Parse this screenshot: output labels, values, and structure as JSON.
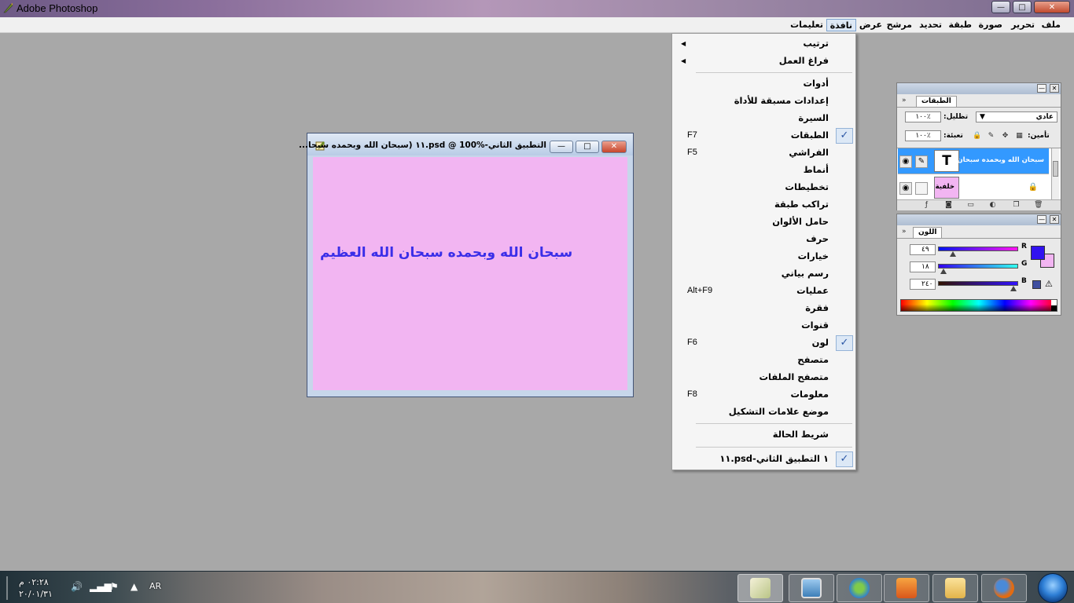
{
  "app": {
    "title": "Adobe Photoshop"
  },
  "window_controls": {
    "minimize": "—",
    "maximize": "□",
    "close": "✕"
  },
  "menubar": {
    "items": [
      {
        "label": "ملف"
      },
      {
        "label": "تحرير"
      },
      {
        "label": "صورة"
      },
      {
        "label": "طبقة"
      },
      {
        "label": "تحديد"
      },
      {
        "label": "مرشح"
      },
      {
        "label": "عرض"
      },
      {
        "label": "نافذة",
        "active": true
      },
      {
        "label": "تعليمات"
      }
    ]
  },
  "window_menu": {
    "items": [
      {
        "label": "ترتيب",
        "submenu": true
      },
      {
        "label": "فراغ العمل",
        "submenu": true
      },
      {
        "label": "أدوات"
      },
      {
        "label": "إعدادات مسبقة للأداة"
      },
      {
        "label": "السيرة"
      },
      {
        "label": "الطبقات",
        "shortcut": "F7",
        "checked": true
      },
      {
        "label": "الفراشي",
        "shortcut": "F5"
      },
      {
        "label": "أنماط"
      },
      {
        "label": "تخطيطات"
      },
      {
        "label": "تراكب طبقة"
      },
      {
        "label": "حامل الألوان"
      },
      {
        "label": "حرف"
      },
      {
        "label": "خيارات"
      },
      {
        "label": "رسم بياني"
      },
      {
        "label": "عمليات",
        "shortcut": "Alt+F9"
      },
      {
        "label": "فقرة"
      },
      {
        "label": "قنوات"
      },
      {
        "label": "لون",
        "shortcut": "F6",
        "checked": true
      },
      {
        "label": "متصفح"
      },
      {
        "label": "متصفح الملفات"
      },
      {
        "label": "معلومات",
        "shortcut": "F8"
      },
      {
        "label": "موضع علامات التشكيل"
      },
      {
        "label": "شريط الحالة"
      },
      {
        "label": "١ التطبيق الثاني-psd.١١",
        "checked": true
      }
    ]
  },
  "document": {
    "title": "التطبيق الثاني-psd @ 100%.١١ (سبحان الله وبحمده سبحا...",
    "canvas_text": "سبحان الله وبحمده سبحان الله العظيم",
    "canvas_color": "#f2b5f2",
    "text_color": "#3a2ee8"
  },
  "layers_panel": {
    "tab": "الطبقات",
    "blend_mode": "عادي",
    "opacity_label": "تظليل:",
    "opacity_value": "١٠٠٪",
    "lock_label": "تأمين:",
    "fill_label": "تعبئة:",
    "fill_value": "١٠٠٪",
    "layers": [
      {
        "name": "سبحان الله وبحمده سبحان ...",
        "thumb": "T",
        "selected": true
      },
      {
        "name": "خلفية",
        "thumb": "",
        "selected": false
      }
    ]
  },
  "color_panel": {
    "tab": "اللون",
    "channels": [
      {
        "name": "R",
        "value": "٤٩",
        "level": 0.19
      },
      {
        "name": "G",
        "value": "١٨",
        "level": 0.07
      },
      {
        "name": "B",
        "value": "٢٤٠",
        "level": 0.94
      }
    ],
    "foreground": "#3112f0",
    "background": "#f2b5f2"
  },
  "taskbar": {
    "time": "٠٢:٢٨ م",
    "date": "٢٠/٠١/٣١",
    "language": "AR"
  }
}
